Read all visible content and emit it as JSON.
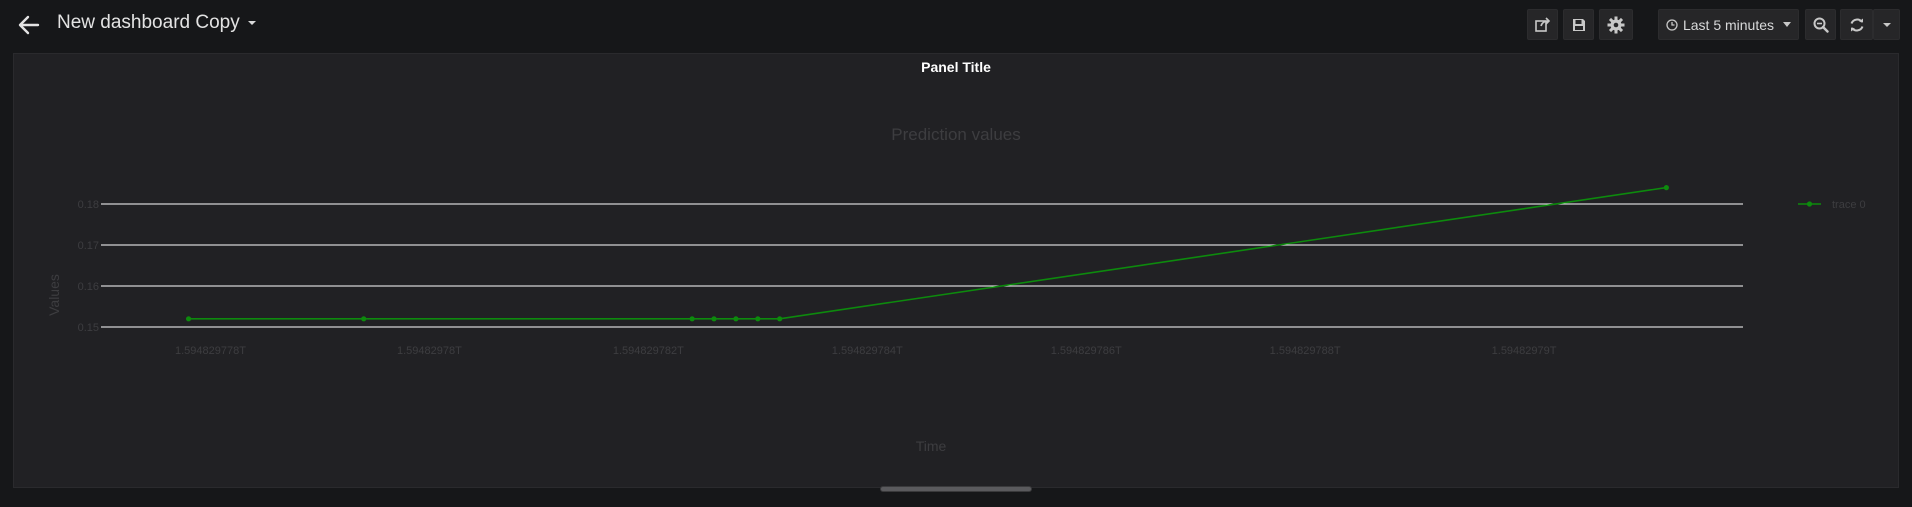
{
  "header": {
    "back_icon": "arrow-left-icon",
    "title": "New dashboard Copy",
    "share_icon": "share-icon",
    "save_icon": "save-icon",
    "settings_icon": "gear-icon",
    "time_picker_icon": "clock-icon",
    "time_range": "Last 5 minutes",
    "zoom_out_icon": "zoom-out-icon",
    "refresh_icon": "refresh-icon",
    "refresh_menu_icon": "chevron-down-icon"
  },
  "panel": {
    "title": "Panel Title"
  },
  "colors": {
    "background": "#161719",
    "panel_bg": "#212124",
    "series": "#0d8a0d",
    "grid": "#ffffff",
    "muted_text": "#3d3d40"
  },
  "chart_data": {
    "type": "line",
    "title": "Prediction values",
    "xlabel": "Time",
    "ylabel": "Values",
    "x_ticks": [
      "1.594829778T",
      "1.59482978T",
      "1.594829782T",
      "1.594829784T",
      "1.594829786T",
      "1.594829788T",
      "1.59482979T"
    ],
    "x_tick_values": [
      1594829778,
      1594829780,
      1594829782,
      1594829784,
      1594829786,
      1594829788,
      1594829790
    ],
    "y_ticks": [
      "0.15",
      "0.16",
      "0.17",
      "0.18"
    ],
    "y_tick_values": [
      0.15,
      0.16,
      0.17,
      0.18
    ],
    "xlim": [
      1594829777.0,
      1594829792.0
    ],
    "ylim": [
      0.15,
      0.18
    ],
    "grid": true,
    "legend_position": "top-right",
    "series": [
      {
        "name": "trace 0",
        "color": "#0d8a0d",
        "x": [
          1594829777.8,
          1594829779.4,
          1594829782.4,
          1594829782.6,
          1594829782.8,
          1594829783.0,
          1594829783.2,
          1594829791.3
        ],
        "y": [
          0.152,
          0.152,
          0.152,
          0.152,
          0.152,
          0.152,
          0.152,
          0.184
        ]
      }
    ]
  }
}
